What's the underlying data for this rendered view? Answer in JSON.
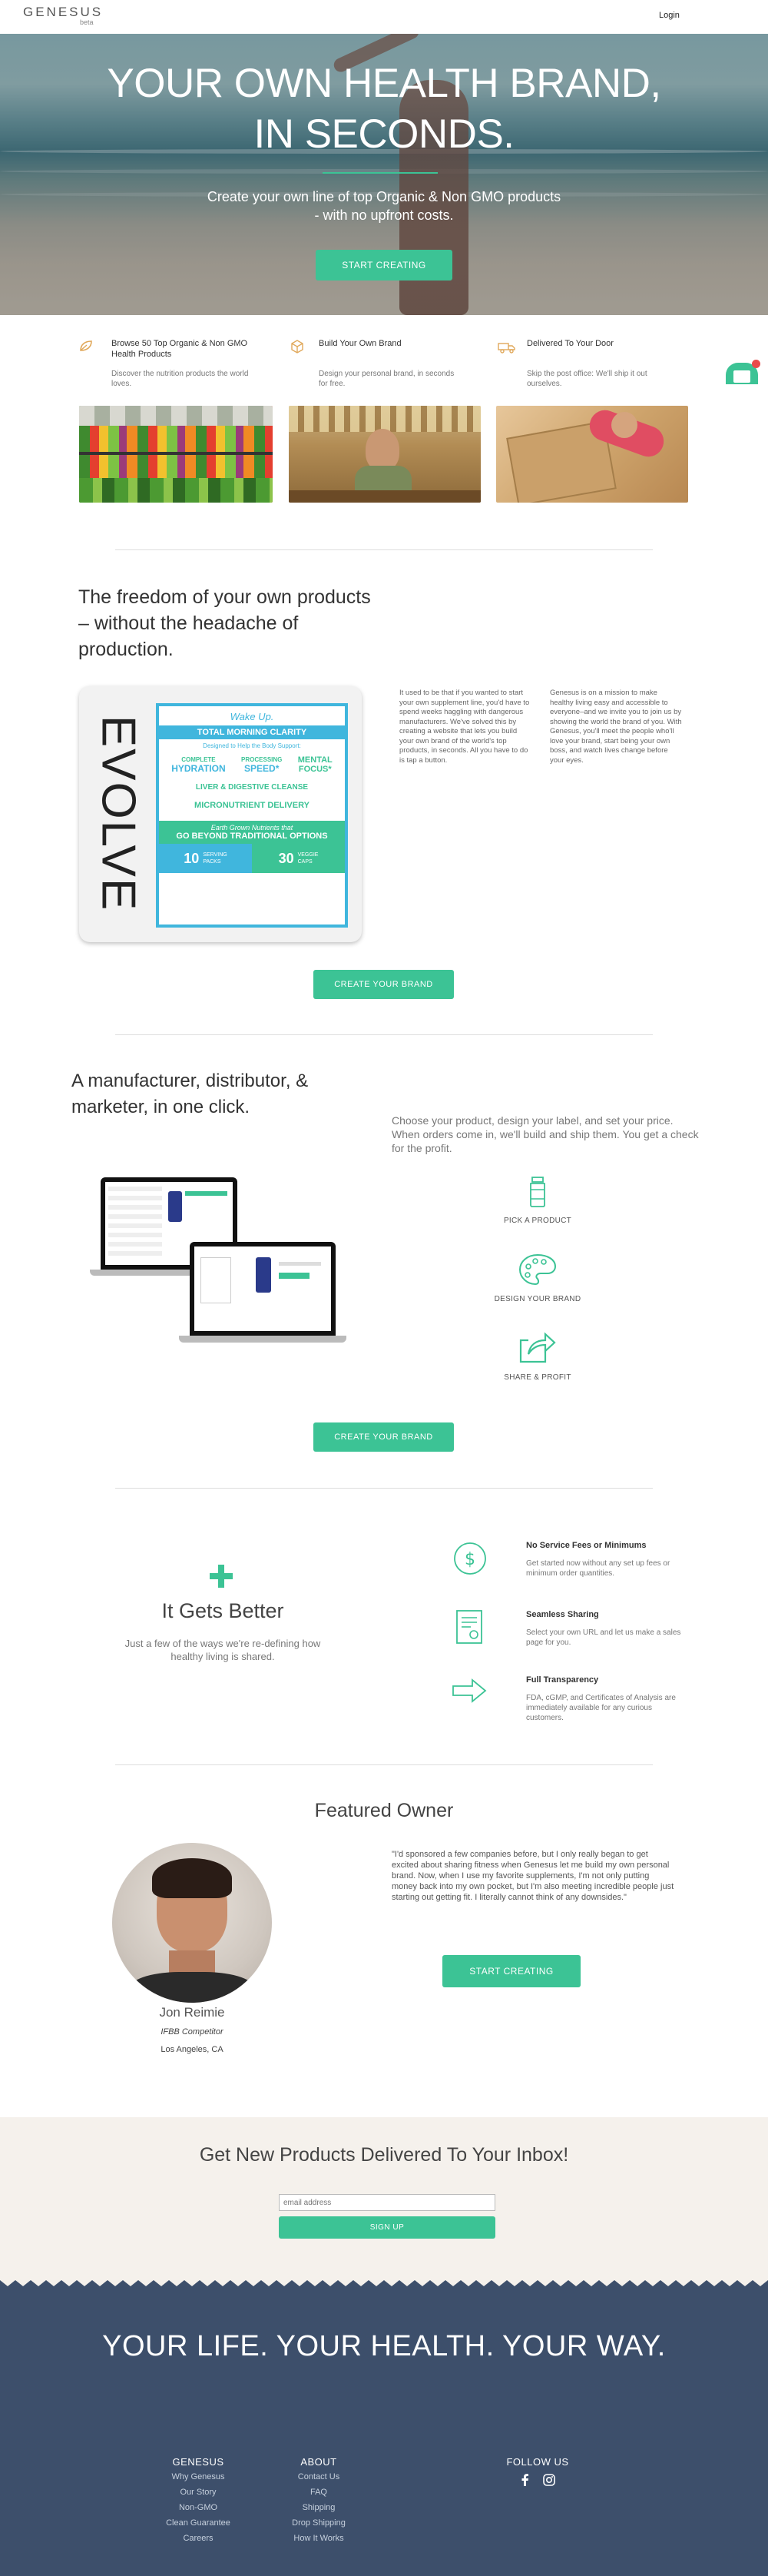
{
  "header": {
    "logo": "GENESUS",
    "logo_sub": "beta",
    "login": "Login"
  },
  "hero": {
    "title_line1": "YOUR OWN HEALTH BRAND,",
    "title_line2": "IN SECONDS.",
    "subtitle_line1": "Create your own line of top Organic & Non GMO products",
    "subtitle_line2": "- with no upfront costs.",
    "cta": "START CREATING"
  },
  "features": [
    {
      "icon": "leaf-icon",
      "title": "Browse 50 Top Organic & Non GMO Health Products",
      "desc": "Discover the nutrition products the world loves."
    },
    {
      "icon": "box-icon",
      "title": "Build Your Own Brand",
      "desc": "Design your personal brand, in seconds for free."
    },
    {
      "icon": "truck-icon",
      "title": "Delivered To Your Door",
      "desc": "Skip the post office: We'll ship it out ourselves."
    }
  ],
  "freedom": {
    "heading": "The freedom of your own products – without the headache of production.",
    "col1": "It used to be that if you wanted to start your own supplement line, you'd have to spend weeks haggling with dangerous manufacturers. We've solved this by creating a website that lets you build your own brand of the world's top products, in seconds. All you have to do is tap a button.",
    "col2": "Genesus is on a mission to make healthy living easy and accessible to everyone–and we invite you to join us by showing the world the brand of you. With Genesus, you'll meet the people who'll love your brand, start being your own boss, and watch lives change before your eyes.",
    "cta": "CREATE YOUR BRAND",
    "label": {
      "brand": "EVOLVE",
      "wake": "Wake Up.",
      "band": "TOTAL MORNING CLARITY",
      "designed": "Designed to Help the Body Support:",
      "complete": "COMPLETE",
      "hydration": "HYDRATION",
      "processing": "PROCESSING",
      "speed": "SPEED*",
      "mental": "MENTAL",
      "focus": "FOCUS*",
      "liver": "LIVER & DIGESTIVE CLEANSE",
      "micro": "MICRONUTRIENT DELIVERY",
      "earth": "Earth Grown Nutrients that",
      "beyond": "GO BEYOND TRADITIONAL OPTIONS",
      "packs_num": "10",
      "packs_l1": "SERVING",
      "packs_l2": "PACKS",
      "caps_num": "30",
      "caps_l1": "VEGGIE",
      "caps_l2": "CAPS"
    }
  },
  "manufacturer": {
    "heading": "A manufacturer, distributor, & marketer, in one click.",
    "desc": "Choose your product, design your label, and set your price. When orders come in, we'll build and ship them. You get a check for the profit.",
    "steps": [
      {
        "icon": "bottle-icon",
        "label": "PICK A PRODUCT"
      },
      {
        "icon": "palette-icon",
        "label": "DESIGN YOUR BRAND"
      },
      {
        "icon": "share-icon",
        "label": "SHARE & PROFIT"
      }
    ],
    "cta": "CREATE YOUR BRAND"
  },
  "better": {
    "title": "It Gets Better",
    "desc": "Just a few of the ways we're re-defining how healthy living is shared.",
    "items": [
      {
        "icon": "dollar-icon",
        "title": "No Service Fees or Minimums",
        "desc": "Get started now without any set up fees or minimum order quantities."
      },
      {
        "icon": "document-icon",
        "title": "Seamless Sharing",
        "desc": "Select your own URL and let us make a sales page for you."
      },
      {
        "icon": "arrow-icon",
        "title": "Full Transparency",
        "desc": "FDA, cGMP, and Certificates of Analysis are immediately available for any curious customers."
      }
    ]
  },
  "owner": {
    "heading": "Featured Owner",
    "name": "Jon Reimie",
    "role": "IFBB Competitor",
    "location": "Los Angeles, CA",
    "quote": "\"I'd sponsored a few companies before, but I only really began to get excited about sharing fitness when Genesus let me build my own personal brand. Now, when I use my favorite supplements, I'm not only putting money back into my own pocket, but I'm also meeting incredible people just starting out getting fit. I literally cannot think of any downsides.\"",
    "cta": "START CREATING"
  },
  "newsletter": {
    "heading": "Get New Products Delivered To Your Inbox!",
    "placeholder": "email address",
    "cta": "SIGN UP"
  },
  "footer": {
    "tagline": "YOUR LIFE. YOUR HEALTH. YOUR WAY.",
    "col1_title": "GENESUS",
    "col1": [
      "Why Genesus",
      "Our Story",
      "Non-GMO",
      "Clean Guarantee",
      "Careers"
    ],
    "col2_title": "ABOUT",
    "col2": [
      "Contact Us",
      "FAQ",
      "Shipping",
      "Drop Shipping",
      "How It Works"
    ],
    "col3_title": "FOLLOW US",
    "social": [
      "facebook-icon",
      "instagram-icon"
    ]
  },
  "colors": {
    "accent": "#3cc395",
    "footer_bg": "#3d4f6b",
    "newsletter_bg": "#f5f1ec"
  }
}
